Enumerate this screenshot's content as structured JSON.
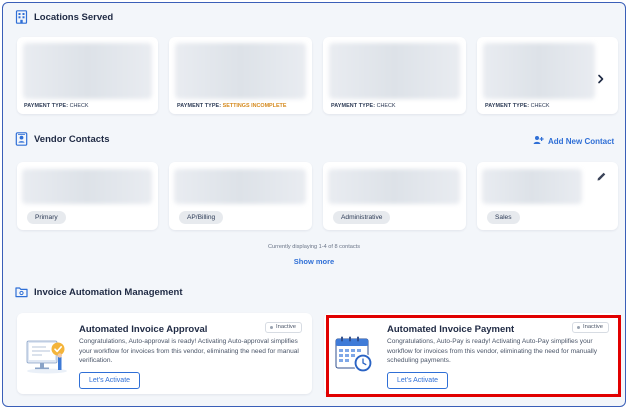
{
  "locations": {
    "title": "Locations Served",
    "cards": [
      {
        "payment_label": "PAYMENT TYPE:",
        "payment_value": "CHECK",
        "status": "normal"
      },
      {
        "payment_label": "PAYMENT TYPE:",
        "payment_value": "SETTINGS INCOMPLETE",
        "status": "warning"
      },
      {
        "payment_label": "PAYMENT TYPE:",
        "payment_value": "CHECK",
        "status": "normal"
      },
      {
        "payment_label": "PAYMENT TYPE:",
        "payment_value": "CHECK",
        "status": "normal"
      }
    ],
    "next_icon": "chevron-right-icon"
  },
  "contacts": {
    "title": "Vendor Contacts",
    "add_label": "Add New Contact",
    "roles": [
      "Primary",
      "AP/Billing",
      "Administrative",
      "Sales"
    ],
    "display_info": "Currently displaying 1-4 of 8 contacts",
    "show_more": "Show more"
  },
  "automation": {
    "title": "Invoice Automation Management",
    "cards": [
      {
        "title": "Automated Invoice Approval",
        "status": "Inactive",
        "description": "Congratulations, Auto-approval is ready! Activating Auto-approval simplifies your workflow for invoices from this vendor, eliminating the need for manual verification.",
        "button": "Let's Activate",
        "icon": "approval-illustration-icon"
      },
      {
        "title": "Automated Invoice Payment",
        "status": "Inactive",
        "description": "Congratulations, Auto-Pay is ready! Activating Auto-Pay simplifies your workflow for invoices from this vendor, eliminating the need for manually scheduling payments.",
        "button": "Let's Activate",
        "icon": "calendar-clock-icon"
      }
    ]
  },
  "colors": {
    "accent": "#2f6fd6",
    "warning": "#d58a1e",
    "highlight": "#e10000",
    "border": "#3a5fb8"
  }
}
